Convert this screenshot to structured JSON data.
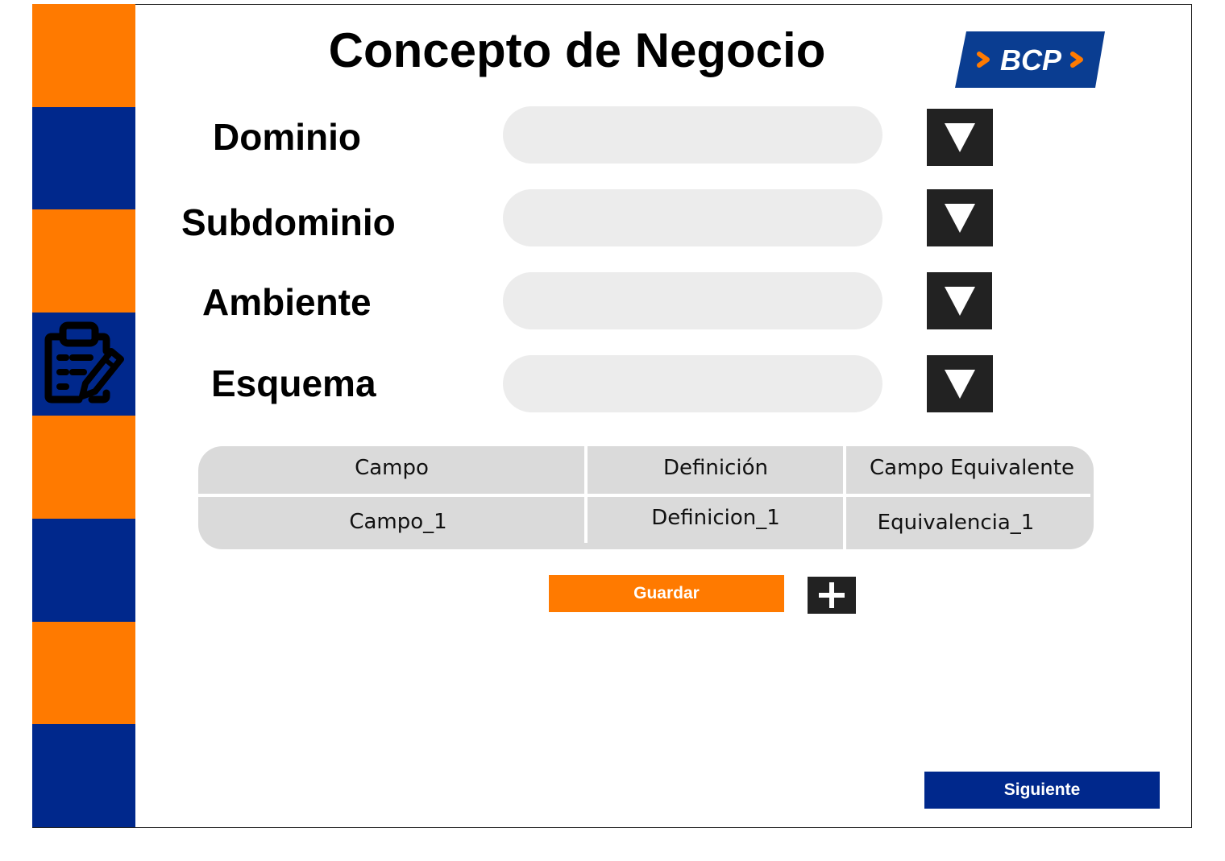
{
  "page": {
    "title": "Concepto de Negocio"
  },
  "logo": {
    "text": "BCP",
    "colors": {
      "background": "#0a3d91",
      "chevrons": "#ff7a00",
      "text": "#ffffff"
    }
  },
  "sidebar": {
    "icon": "clipboard-edit-icon",
    "colors": {
      "orange": "#ff7a00",
      "blue": "#00288c"
    }
  },
  "form": {
    "fields": [
      {
        "label": "Dominio",
        "value": "",
        "dropdown_icon": "triangle-down-icon"
      },
      {
        "label": "Subdominio",
        "value": "",
        "dropdown_icon": "triangle-down-icon"
      },
      {
        "label": "Ambiente",
        "value": "",
        "dropdown_icon": "triangle-down-icon"
      },
      {
        "label": "Esquema",
        "value": "",
        "dropdown_icon": "triangle-down-icon"
      }
    ]
  },
  "table": {
    "headers": [
      "Campo",
      "Definición",
      "Campo Equivalente"
    ],
    "rows": [
      [
        "Campo_1",
        "Definicion_1",
        "Equivalencia_1"
      ]
    ]
  },
  "actions": {
    "save_label": "Guardar",
    "add_icon": "plus-icon",
    "next_label": "Siguiente"
  }
}
